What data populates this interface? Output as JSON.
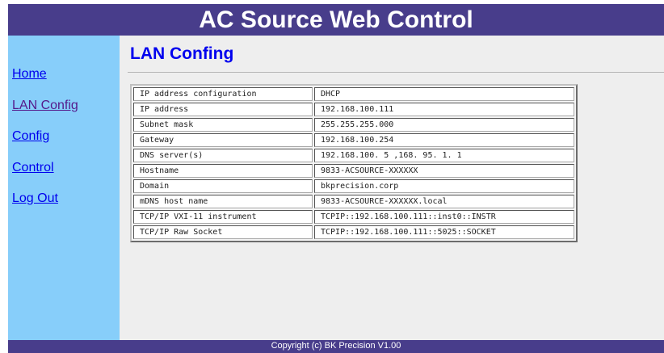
{
  "header": {
    "title": "AC Source Web Control"
  },
  "sidebar": {
    "items": [
      {
        "label": "Home"
      },
      {
        "label": "LAN Config"
      },
      {
        "label": "Config"
      },
      {
        "label": "Control"
      },
      {
        "label": "Log Out"
      }
    ]
  },
  "main": {
    "title": "LAN Confing",
    "table": [
      {
        "key": "IP address configuration",
        "value": "DHCP"
      },
      {
        "key": "IP address",
        "value": "192.168.100.111"
      },
      {
        "key": "Subnet mask",
        "value": "255.255.255.000"
      },
      {
        "key": "Gateway",
        "value": "192.168.100.254"
      },
      {
        "key": "DNS server(s)",
        "value": "192.168.100. 5 ,168. 95. 1. 1"
      },
      {
        "key": "Hostname",
        "value": "9833-ACSOURCE-XXXXXX"
      },
      {
        "key": "Domain",
        "value": "bkprecision.corp"
      },
      {
        "key": "mDNS host name",
        "value": "9833-ACSOURCE-XXXXXX.local"
      },
      {
        "key": "TCP/IP VXI-11 instrument",
        "value": "TCPIP::192.168.100.111::inst0::INSTR"
      },
      {
        "key": "TCP/IP Raw Socket",
        "value": "TCPIP::192.168.100.111::5025::SOCKET"
      }
    ]
  },
  "footer": {
    "text": "Copyright (c) BK Precision V1.00"
  },
  "colors": {
    "banner": "#483d8b",
    "sidebar": "#87cefa",
    "content": "#eeeeee",
    "link": "#0000ee",
    "visited_link": "#551a8b"
  }
}
